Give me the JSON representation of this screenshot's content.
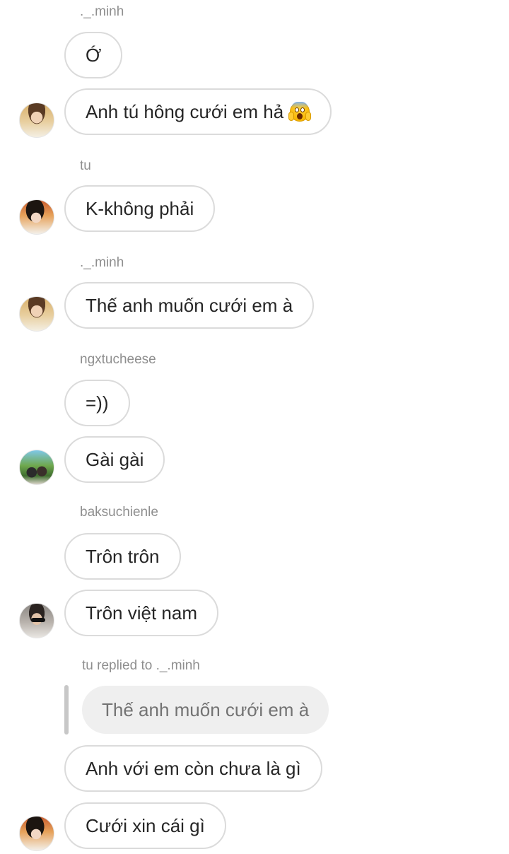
{
  "messages": [
    {
      "sender": "._.minh"
    },
    {
      "text": "Ớ"
    },
    {
      "text": "Anh tú hông cưới em hả",
      "emoji": "face-screaming-in-fear-icon"
    },
    {
      "sender": "tu"
    },
    {
      "text": "K-không phải"
    },
    {
      "sender": "._.minh"
    },
    {
      "text": "Thế anh muốn cưới em à"
    },
    {
      "sender": "ngxtucheese"
    },
    {
      "text": "=))"
    },
    {
      "text": "Gài gài"
    },
    {
      "sender": "baksuchienle"
    },
    {
      "text": "Trôn trôn"
    },
    {
      "text": "Trôn việt nam"
    },
    {
      "reply_label": "tu replied to ._.minh"
    },
    {
      "quoted_text": "Thế anh muốn cưới em à"
    },
    {
      "text": "Anh với em còn chưa là gì"
    },
    {
      "text": "Cưới xin cái gì"
    }
  ],
  "avatars": {
    "minh": "profile-avatar-minh",
    "tu": "profile-avatar-tu",
    "ngxtucheese": "profile-avatar-ngxtucheese",
    "baksuchienle": "profile-avatar-baksuchienle"
  },
  "colors": {
    "bubble_border": "#dbdbdb",
    "quoted_bg": "#efefef",
    "sender_text": "#8e8e8e",
    "reply_bar": "#c7c7c7"
  }
}
